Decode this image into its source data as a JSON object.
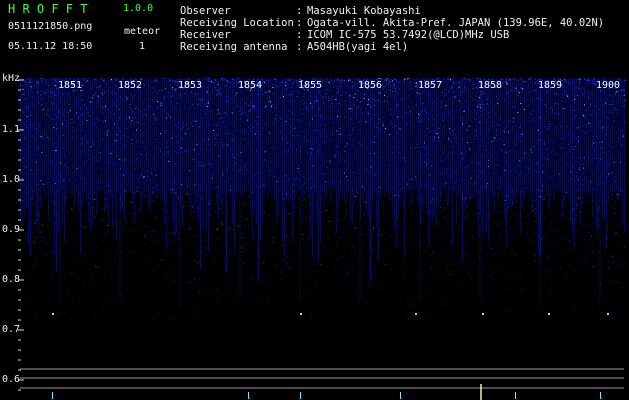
{
  "app": {
    "title": "H R O F F T",
    "version": "1.0.0",
    "file_name": "0511121850.png",
    "datetime": "05.11.12 18:50",
    "mode_label": "meteor",
    "meteor_count": "1"
  },
  "header": {
    "rows": [
      {
        "label": "Observer",
        "value": "Masayuki Kobayashi"
      },
      {
        "label": "Receiving Location",
        "value": "Ogata-vill. Akita-Pref. JAPAN (139.96E, 40.02N)"
      },
      {
        "label": "Receiver",
        "value": "ICOM IC-575 53.7492(@LCD)MHz USB"
      },
      {
        "label": "Receiving antenna",
        "value": "A504HB(yagi 4el)"
      }
    ],
    "separator": ":"
  },
  "y_axis": {
    "unit": "kHz",
    "ticks": [
      "1.1",
      "1.0",
      "0.9",
      "0.8",
      "0.7",
      "0.6"
    ]
  },
  "x_axis": {
    "ticks": [
      "1851",
      "1852",
      "1853",
      "1854",
      "1855",
      "1856",
      "1857",
      "1858",
      "1859",
      "1900"
    ]
  },
  "colors": {
    "text_green": "#3cff3c",
    "text_white": "#f0f0f0",
    "background": "#000000",
    "noise_blue": "#1a2cff",
    "ref_lines": "#9a9a9a",
    "echo_trace": "#7fe0ff"
  }
}
